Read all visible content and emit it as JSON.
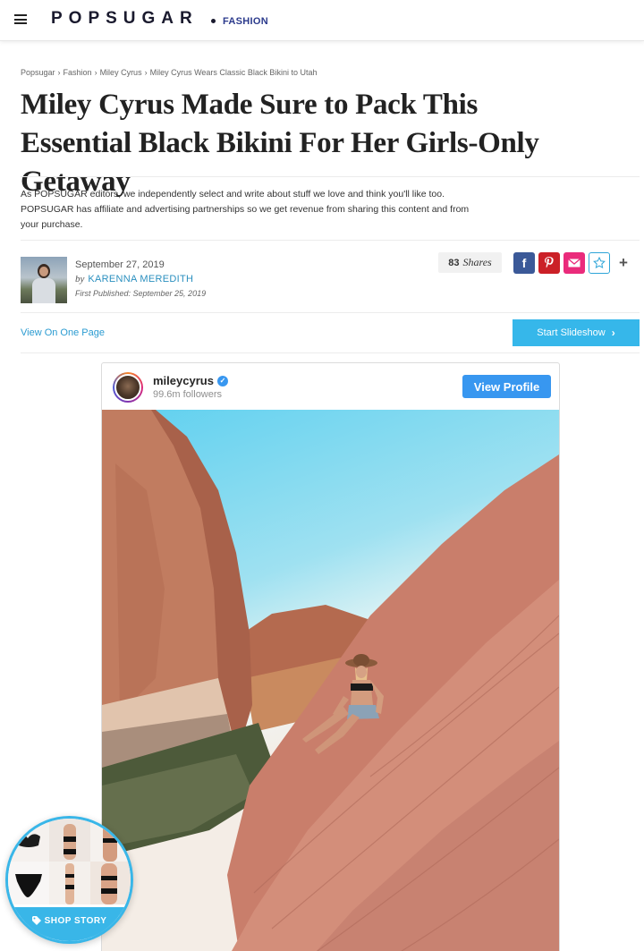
{
  "header": {
    "logo": "POPSUGAR",
    "section": "FASHION"
  },
  "breadcrumb": [
    "Popsugar",
    "Fashion",
    "Miley Cyrus",
    "Miley Cyrus Wears Classic Black Bikini to Utah"
  ],
  "article": {
    "title": "Miley Cyrus Made Sure to Pack This Essential Black Bikini For Her Girls-Only Getaway",
    "disclaimer": "As POPSUGAR editors, we independently select and write about stuff we love and think you'll like too. POPSUGAR has affiliate and advertising partnerships so we get revenue from sharing this content and from your purchase.",
    "date": "September 27, 2019",
    "by": "by",
    "author": "KARENNA MEREDITH",
    "first_published": "First Published: September 25, 2019"
  },
  "shares": {
    "count": "83",
    "label": "Shares"
  },
  "social": {
    "icons": [
      "facebook-icon",
      "pinterest-icon",
      "email-icon",
      "star-icon",
      "plus-icon"
    ]
  },
  "actions": {
    "view_one_page": "View On One Page",
    "start_slideshow": "Start Slideshow"
  },
  "instagram": {
    "username": "mileycyrus",
    "followers": "99.6m followers",
    "button": "View Profile"
  },
  "shop": {
    "label": "SHOP STORY"
  },
  "colors": {
    "accent": "#36b7ea",
    "brand": "#1a1a2e",
    "link": "#2a9bd1",
    "instagram_blue": "#3897f0"
  }
}
